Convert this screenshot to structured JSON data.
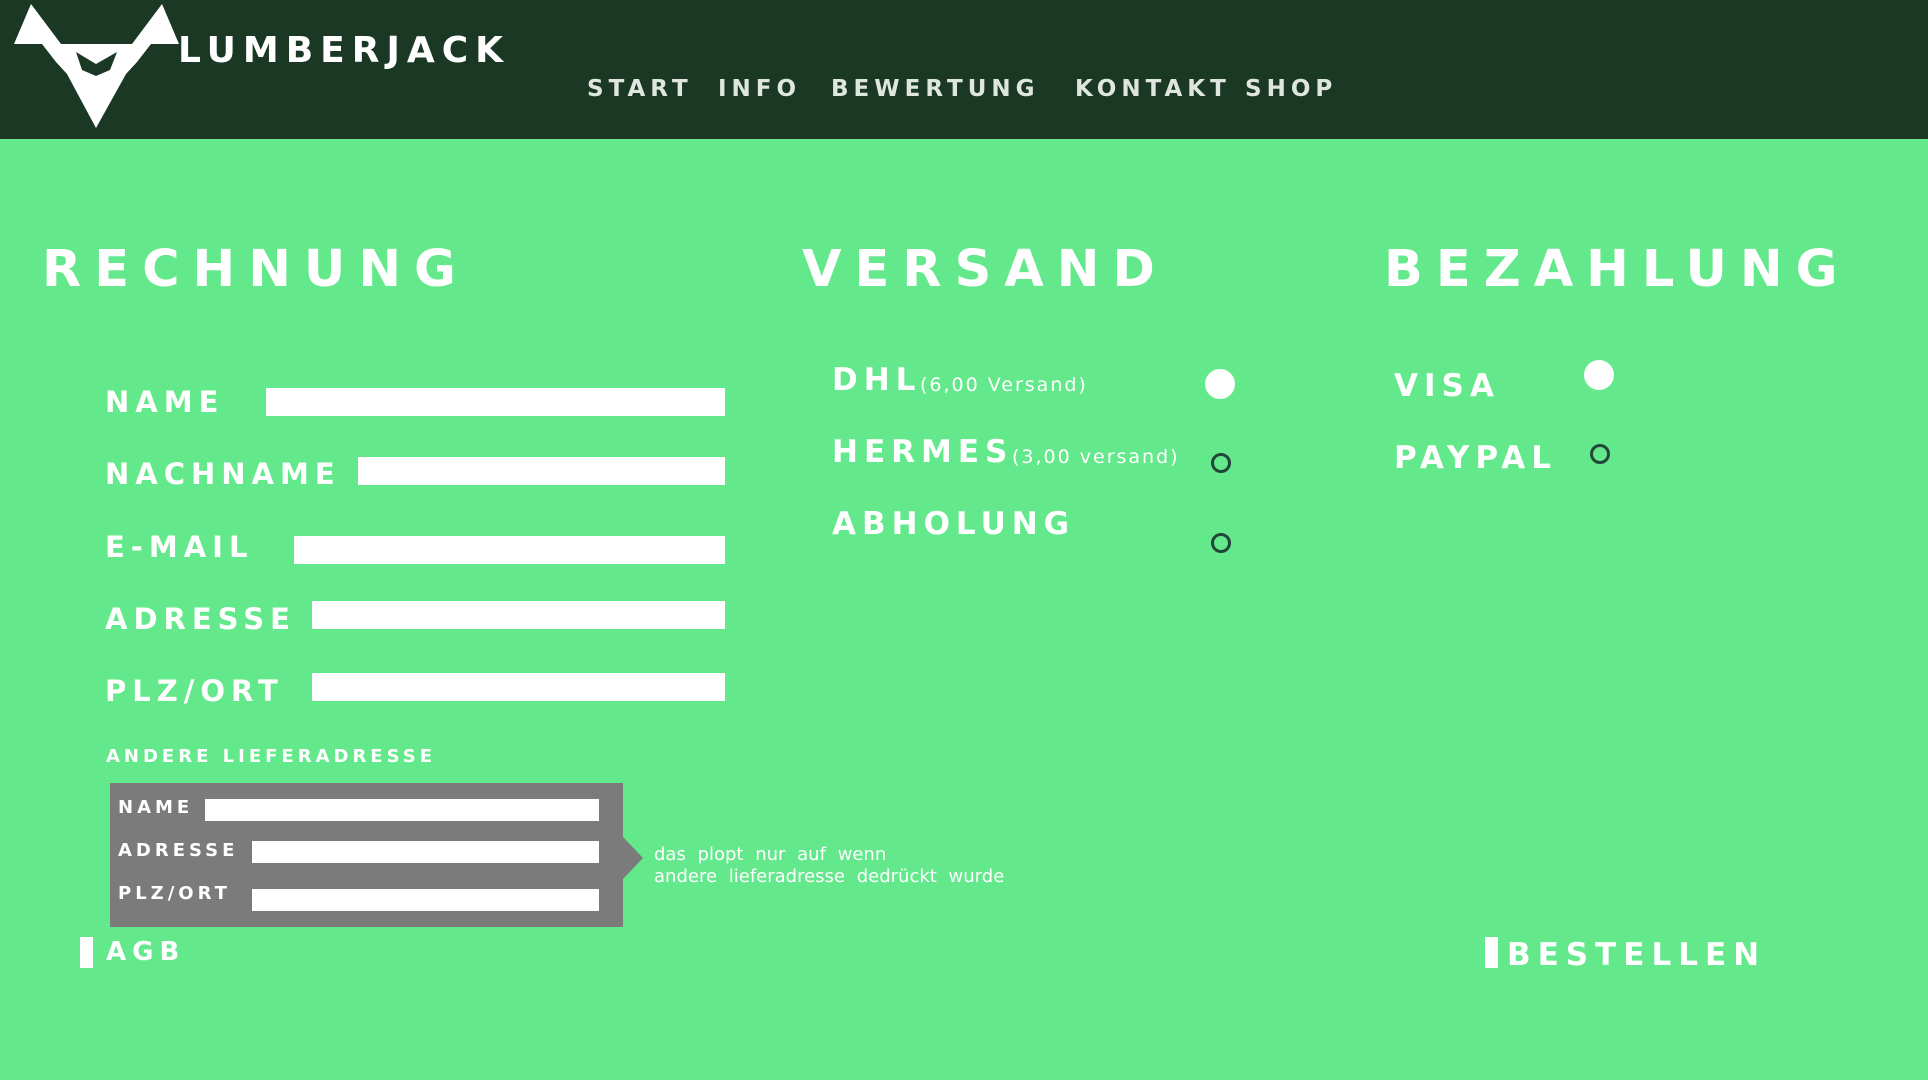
{
  "brand": {
    "name": "LUMBERJACK"
  },
  "nav": {
    "items": [
      "START",
      "INFO",
      "BEWERTUNG",
      "KONTAKT",
      "SHOP"
    ]
  },
  "billing": {
    "heading": "RECHNUNG",
    "fields": [
      {
        "label": "NAME",
        "value": ""
      },
      {
        "label": "NACHNAME",
        "value": ""
      },
      {
        "label": "E-MAIL",
        "value": ""
      },
      {
        "label": "ADRESSE",
        "value": ""
      },
      {
        "label": "PLZ/ORT",
        "value": ""
      }
    ],
    "alt_address": {
      "heading": "ANDERE LIEFERADRESSE",
      "fields": [
        {
          "label": "NAME",
          "value": ""
        },
        {
          "label": "ADRESSE",
          "value": ""
        },
        {
          "label": "PLZ/ORT",
          "value": ""
        }
      ],
      "note_line1": "das plopt nur auf wenn",
      "note_line2": "andere lieferadresse dedrückt wurde"
    },
    "agb_label": "AGB"
  },
  "shipping": {
    "heading": "VERSAND",
    "options": [
      {
        "label": "DHL",
        "sub": "(6,00 Versand)",
        "selected": true
      },
      {
        "label": "HERMES",
        "sub": "(3,00 versand)",
        "selected": false
      },
      {
        "label": "ABHOLUNG",
        "sub": "",
        "selected": false
      }
    ]
  },
  "payment": {
    "heading": "BEZAHLUNG",
    "options": [
      {
        "label": "VISA",
        "selected": true
      },
      {
        "label": "PAYPAL",
        "selected": false
      }
    ],
    "order_label": "BESTELLEN"
  },
  "colors": {
    "background": "#63e98b",
    "header": "#1a3823",
    "popup": "#7b7b7b",
    "text": "#ffffff"
  },
  "icons": {
    "logo": "bull-head-icon"
  }
}
